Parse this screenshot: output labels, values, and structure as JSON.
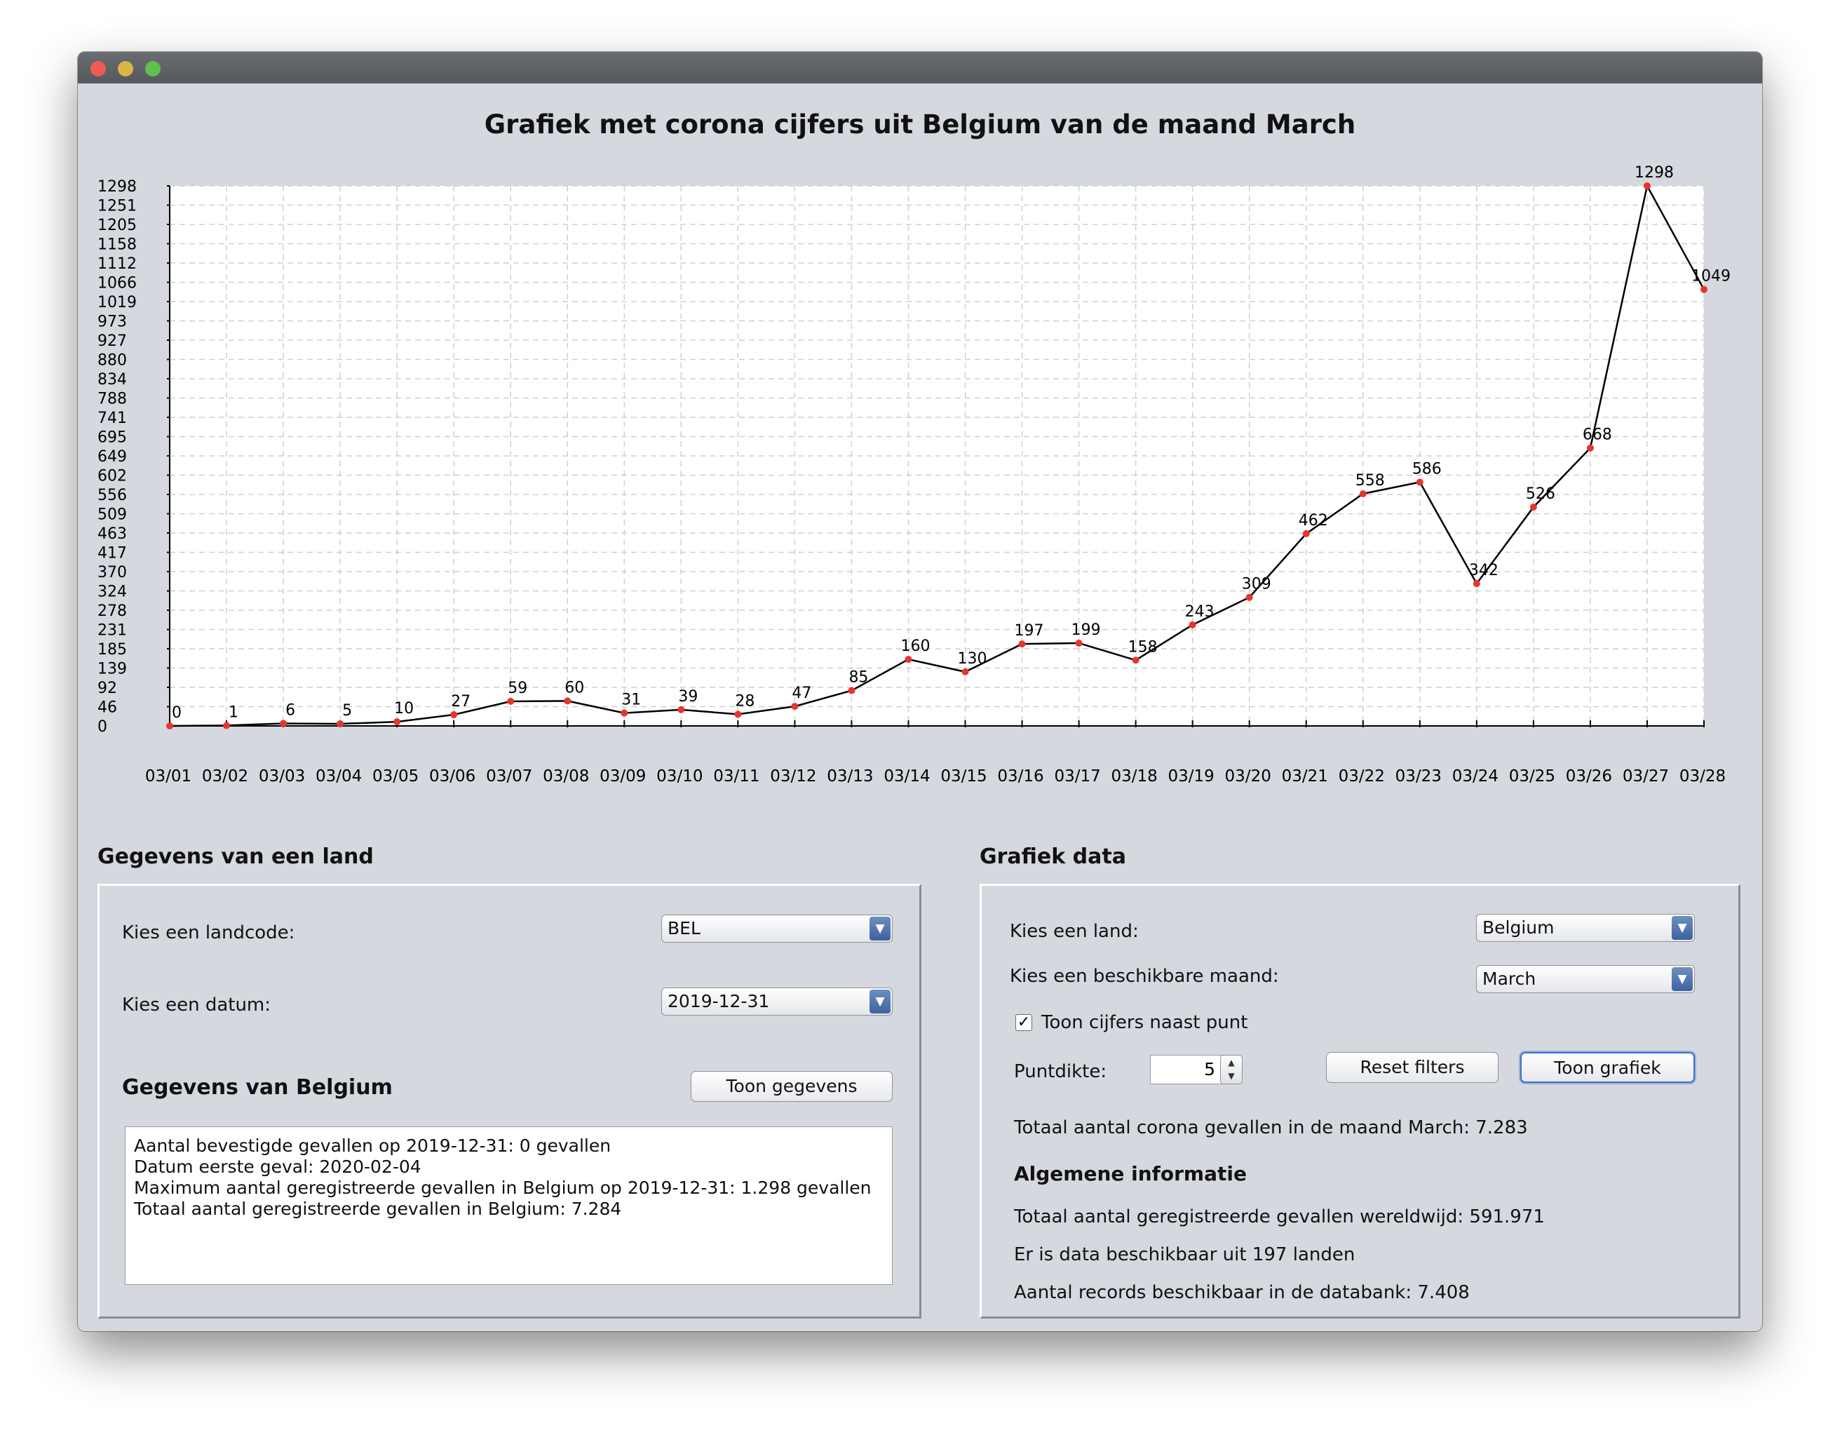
{
  "window": {
    "title": "",
    "chart_title": "Grafiek met corona cijfers uit Belgium van de maand March"
  },
  "chart_data": {
    "type": "line",
    "title": "Grafiek met corona cijfers uit Belgium van de maand March",
    "categories": [
      "03/01",
      "03/02",
      "03/03",
      "03/04",
      "03/05",
      "03/06",
      "03/07",
      "03/08",
      "03/09",
      "03/10",
      "03/11",
      "03/12",
      "03/13",
      "03/14",
      "03/15",
      "03/16",
      "03/17",
      "03/18",
      "03/19",
      "03/20",
      "03/21",
      "03/22",
      "03/23",
      "03/24",
      "03/25",
      "03/26",
      "03/27",
      "03/28"
    ],
    "series": [
      {
        "values": [
          0,
          1,
          6,
          5,
          10,
          27,
          59,
          60,
          31,
          39,
          28,
          47,
          85,
          160,
          130,
          197,
          199,
          158,
          243,
          309,
          462,
          558,
          586,
          342,
          526,
          668,
          1298,
          1049
        ]
      }
    ],
    "y_ticks": [
      "0",
      "46",
      "92",
      "139",
      "185",
      "231",
      "278",
      "324",
      "370",
      "417",
      "463",
      "509",
      "556",
      "602",
      "649",
      "695",
      "741",
      "788",
      "834",
      "880",
      "927",
      "973",
      "1019",
      "1066",
      "1112",
      "1158",
      "1205",
      "1251",
      "1298"
    ],
    "ylim": [
      0,
      1298
    ],
    "xlabel": "",
    "ylabel": "",
    "grid": true,
    "show_point_labels": true,
    "line_color": "#000000",
    "point_color": "#e8352b",
    "grid_color": "#d0d0d0"
  },
  "left_section": {
    "title": "Gegevens van een land",
    "landcode_label": "Kies een landcode:",
    "landcode_value": "BEL",
    "datum_label": "Kies een datum:",
    "datum_value": "2019-12-31",
    "data_title": "Gegevens van Belgium",
    "show_button": "Toon gegevens",
    "info_lines": [
      "Aantal bevestigde gevallen op 2019-12-31: 0 gevallen",
      "Datum eerste geval: 2020-02-04",
      "Maximum aantal geregistreerde gevallen in Belgium op 2019-12-31: 1.298 gevallen",
      "Totaal aantal geregistreerde gevallen in Belgium: 7.284"
    ]
  },
  "right_section": {
    "title": "Grafiek data",
    "country_label": "Kies een land:",
    "country_value": "Belgium",
    "month_label": "Kies een beschikbare maand:",
    "month_value": "March",
    "checkbox_label": "Toon cijfers naast punt",
    "checkbox_checked": "✓",
    "dot_size_label": "Puntdikte:",
    "dot_size_value": "5",
    "reset_button": "Reset filters",
    "show_chart_button": "Toon grafiek",
    "total_month": "Totaal aantal corona gevallen in de maand March: 7.283",
    "general_title": "Algemene informatie",
    "total_world": "Totaal aantal geregistreerde gevallen wereldwijd: 591.971",
    "countries": "Er is data beschikbaar uit 197 landen",
    "records": "Aantal records beschikbaar in de databank: 7.408"
  }
}
